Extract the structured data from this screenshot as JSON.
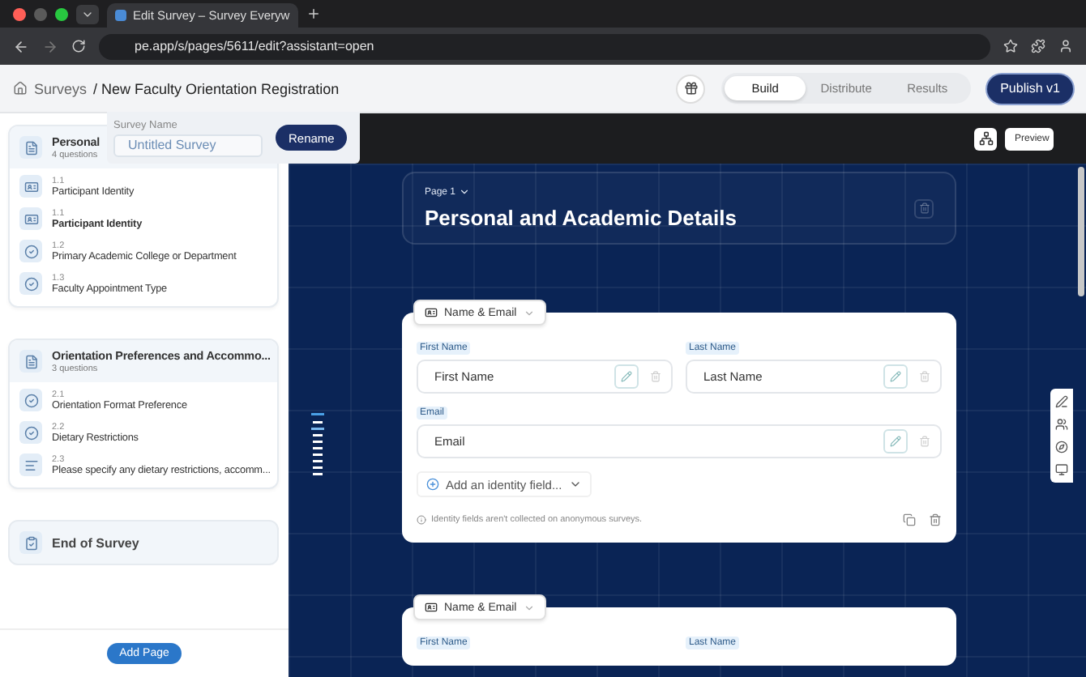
{
  "browser": {
    "tab_title": "Edit Survey – Survey Everyw",
    "url": "pe.app/s/pages/5611/edit?assistant=open"
  },
  "header": {
    "root": "Surveys",
    "title": "/ New Faculty Orientation Registration",
    "mode_tabs": [
      {
        "label": "Build",
        "selected": true
      },
      {
        "label": "Distribute",
        "selected": false
      },
      {
        "label": "Results",
        "selected": false
      }
    ],
    "publish": "Publish v1"
  },
  "rename_popover": {
    "label": "Survey Name",
    "value": "Untitled Survey",
    "button": "Rename"
  },
  "sidebar": {
    "pages": [
      {
        "title": "Personal",
        "subtitle": "4 questions",
        "questions": [
          {
            "kind": "identity",
            "number": "1.1",
            "label": "Participant Identity",
            "selected": false
          },
          {
            "kind": "identity",
            "number": "1.1",
            "label": "Participant Identity",
            "selected": true
          },
          {
            "kind": "choice",
            "number": "1.2",
            "label": "Primary Academic College or Department",
            "selected": false
          },
          {
            "kind": "choice",
            "number": "1.3",
            "label": "Faculty Appointment Type",
            "selected": false
          }
        ]
      },
      {
        "title": "Orientation Preferences and Accommo...",
        "subtitle": "3 questions",
        "questions": [
          {
            "kind": "choice",
            "number": "2.1",
            "label": "Orientation Format Preference",
            "selected": false
          },
          {
            "kind": "choice",
            "number": "2.2",
            "label": "Dietary Restrictions",
            "selected": false
          },
          {
            "kind": "text",
            "number": "2.3",
            "label": "Please specify any dietary restrictions, accomm...",
            "selected": false
          }
        ]
      }
    ],
    "end": "End of Survey",
    "add_page": "Add Page"
  },
  "canvas": {
    "preview": "Preview",
    "page_label": "Page 1",
    "page_title": "Personal and Academic Details",
    "cards": [
      {
        "type_label": "Name & Email",
        "fields": [
          {
            "label": "First Name",
            "placeholder": "First Name"
          },
          {
            "label": "Last Name",
            "placeholder": "Last Name"
          },
          {
            "label": "Email",
            "placeholder": "Email"
          }
        ],
        "add_field": "Add an identity field...",
        "note": "Identity fields aren't collected on anonymous surveys."
      },
      {
        "type_label": "Name & Email",
        "fields": [
          {
            "label": "First Name"
          },
          {
            "label": "Last Name"
          }
        ]
      }
    ]
  }
}
